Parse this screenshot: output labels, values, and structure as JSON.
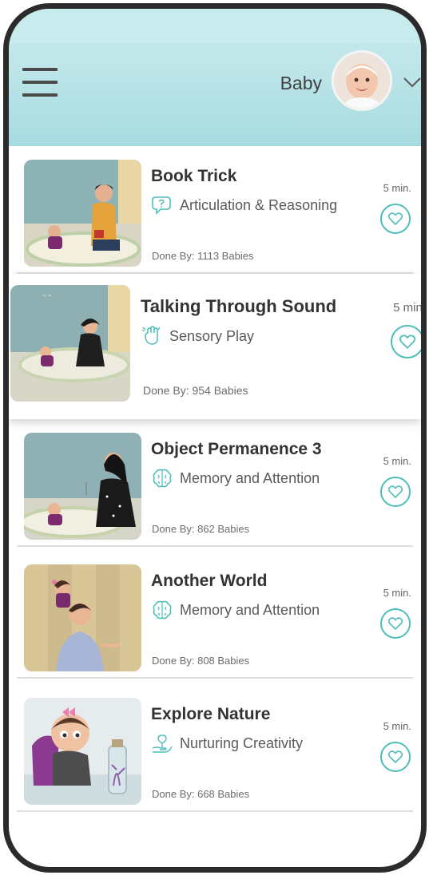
{
  "header": {
    "user_name": "Baby",
    "colors": {
      "header_top": "#c6e9ec",
      "header_bottom": "#a6dbe0",
      "accent": "#4dbdba"
    },
    "icons": {
      "menu": "hamburger-menu-icon",
      "avatar": "baby-avatar",
      "dropdown": "chevron-down-icon"
    }
  },
  "activities": [
    {
      "title": "Book Trick",
      "category": "Articulation & Reasoning",
      "category_icon": "speech-bubble-icon",
      "done_by": "Done By: 1113 Babies",
      "duration": "5 min."
    },
    {
      "title": "Talking Through Sound",
      "category": "Sensory Play",
      "category_icon": "hand-icon",
      "done_by": "Done By: 954 Babies",
      "duration": "5 min."
    },
    {
      "title": "Object Permanence 3",
      "category": "Memory and Attention",
      "category_icon": "brain-icon",
      "done_by": "Done By: 862 Babies",
      "duration": "5 min."
    },
    {
      "title": "Another World",
      "category": "Memory and Attention",
      "category_icon": "brain-icon",
      "done_by": "Done By: 808 Babies",
      "duration": "5 min."
    },
    {
      "title": "Explore Nature",
      "category": "Nurturing Creativity",
      "category_icon": "plant-in-hand-icon",
      "done_by": "Done By: 668 Babies",
      "duration": "5 min."
    }
  ]
}
